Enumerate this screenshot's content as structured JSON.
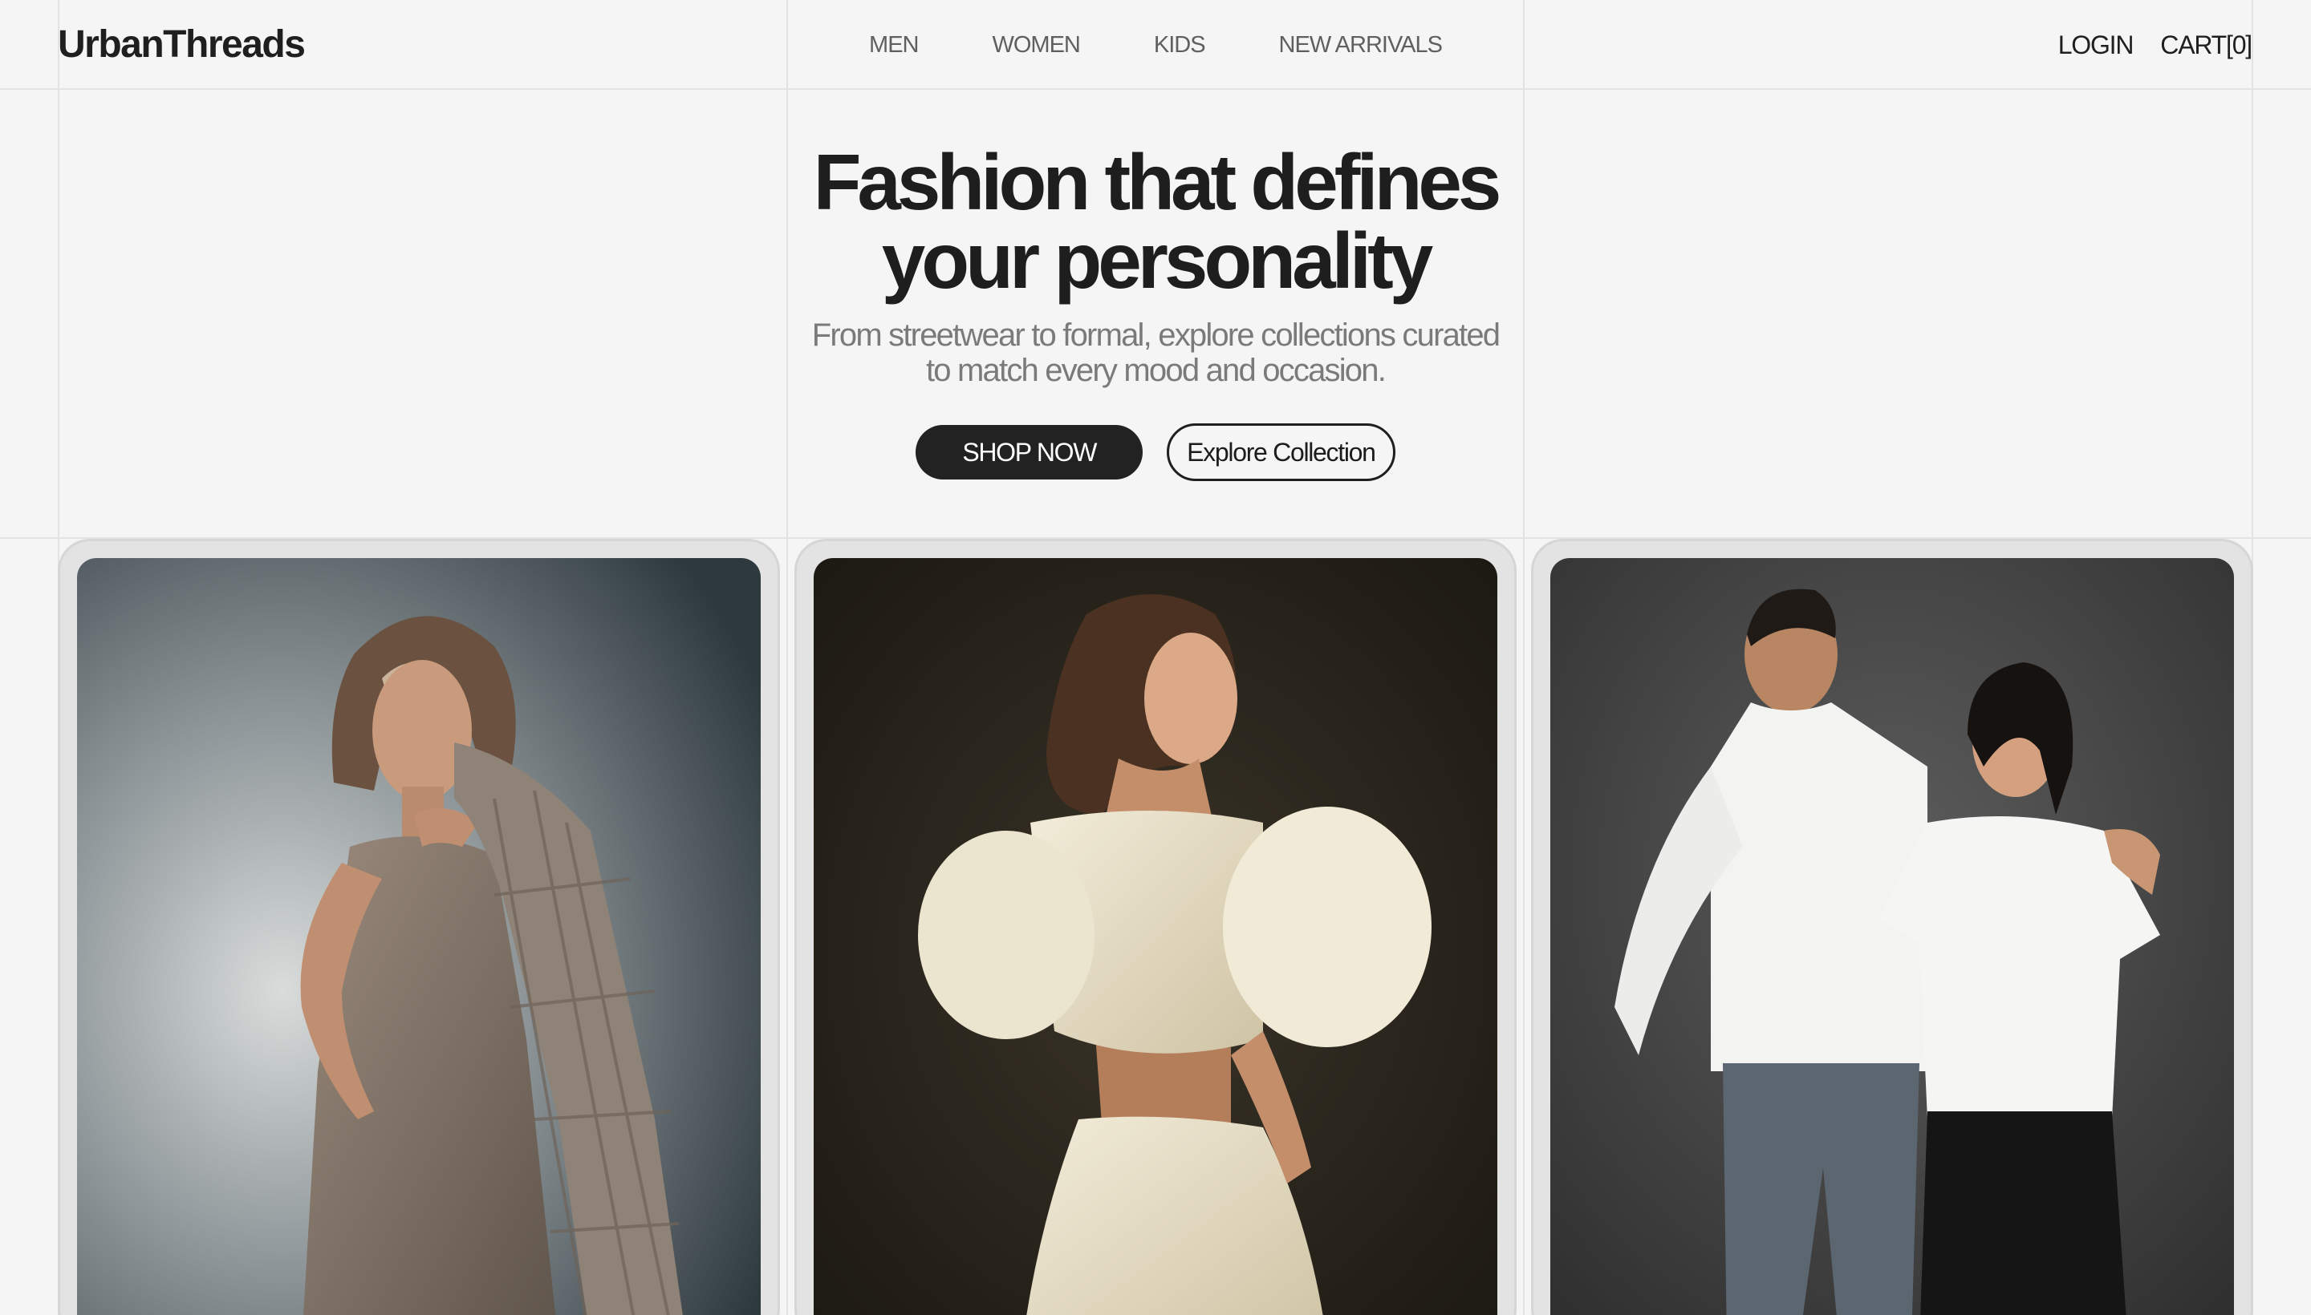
{
  "brand": {
    "name": "UrbanThreads"
  },
  "nav": {
    "items": [
      {
        "label": "MEN"
      },
      {
        "label": "WOMEN"
      },
      {
        "label": "KIDS"
      },
      {
        "label": "NEW ARRIVALS"
      }
    ]
  },
  "account": {
    "login_label": "LOGIN",
    "cart_label": "CART[0]"
  },
  "hero": {
    "title_line1": "Fashion that defines",
    "title_line2": "your personality",
    "subtitle_line1": "From streetwear to formal, explore collections curated",
    "subtitle_line2": "to match every mood and occasion.",
    "primary_cta": "SHOP NOW",
    "secondary_cta": "Explore Collection"
  },
  "gallery": {
    "cards": [
      {
        "subject": "Woman in beige linen dress holding a plaid blazer over her shoulder"
      },
      {
        "subject": "Woman in white puff-sleeve open-back dress"
      },
      {
        "subject": "Couple wearing white tops and dark jeans"
      }
    ]
  },
  "colors": {
    "background": "#f5f5f5",
    "text_primary": "#1e1e1e",
    "text_muted": "#7a7a7a",
    "button_dark": "#222222",
    "card_frame": "#e3e3e3",
    "grid_line": "#e3e3e3"
  }
}
